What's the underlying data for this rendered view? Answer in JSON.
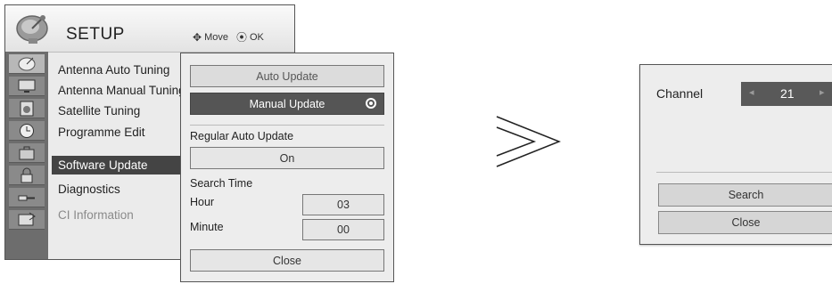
{
  "setup": {
    "title": "SETUP",
    "hint_move": "Move",
    "hint_ok": "OK",
    "icons": [
      "satellite-dish-icon",
      "monitor-icon",
      "speaker-icon",
      "clock-icon",
      "briefcase-icon",
      "lock-icon",
      "connector-icon",
      "input-icon"
    ],
    "menu": [
      {
        "label": "Antenna Auto Tuning"
      },
      {
        "label": "Antenna Manual Tuning"
      },
      {
        "label": "Satellite Tuning"
      },
      {
        "label": "Programme Edit"
      },
      {
        "label": "Software Update"
      },
      {
        "label": "Diagnostics"
      },
      {
        "label": "CI Information"
      }
    ],
    "selected_item": "Software Update",
    "disabled_item": "CI Information"
  },
  "software_update": {
    "auto_update": "Auto Update",
    "manual_update": "Manual Update",
    "regular_auto_update_label": "Regular Auto Update",
    "regular_auto_update_value": "On",
    "search_time_label": "Search Time",
    "hour_label": "Hour",
    "hour_value": "03",
    "minute_label": "Minute",
    "minute_value": "00",
    "close": "Close"
  },
  "channel_dialog": {
    "channel_label": "Channel",
    "channel_value": "21",
    "search": "Search",
    "close": "Close"
  },
  "colors": {
    "selected_bg": "#444444",
    "panel_bg": "#ededed",
    "icon_column": "#6d6d6d"
  }
}
